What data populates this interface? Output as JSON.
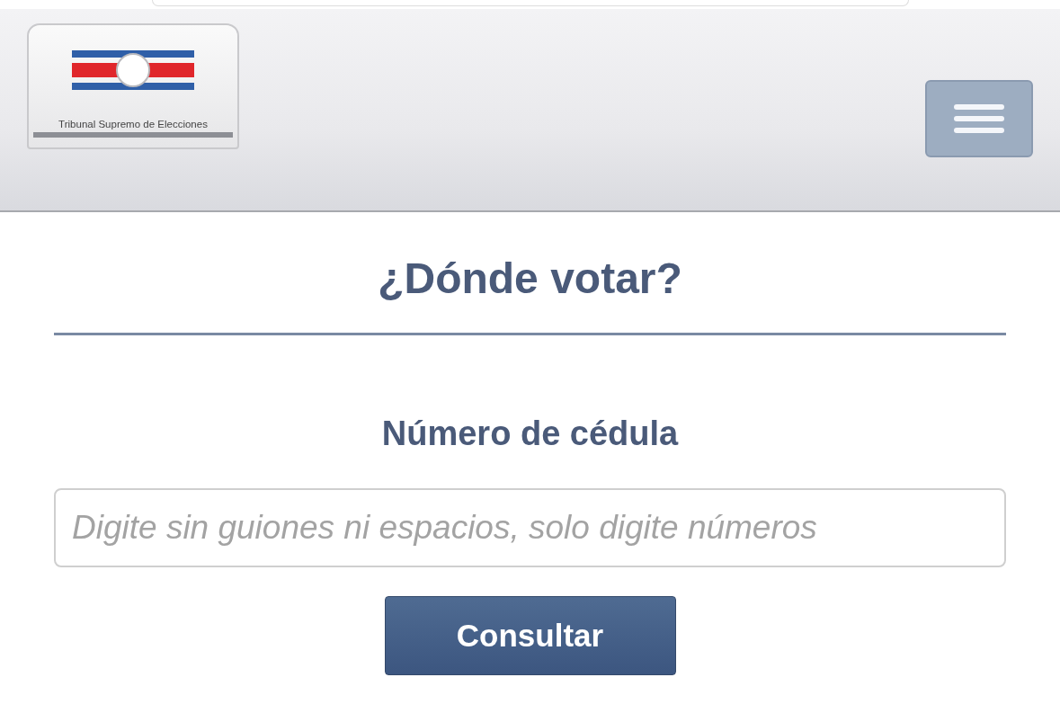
{
  "header": {
    "logo": {
      "caption": "Tribunal Supremo de Elecciones"
    }
  },
  "title": "¿Dónde votar?",
  "form": {
    "label": "Número de cédula",
    "input": {
      "placeholder": "Digite sin guiones ni espacios, solo digite números"
    },
    "button": "Consultar"
  }
}
